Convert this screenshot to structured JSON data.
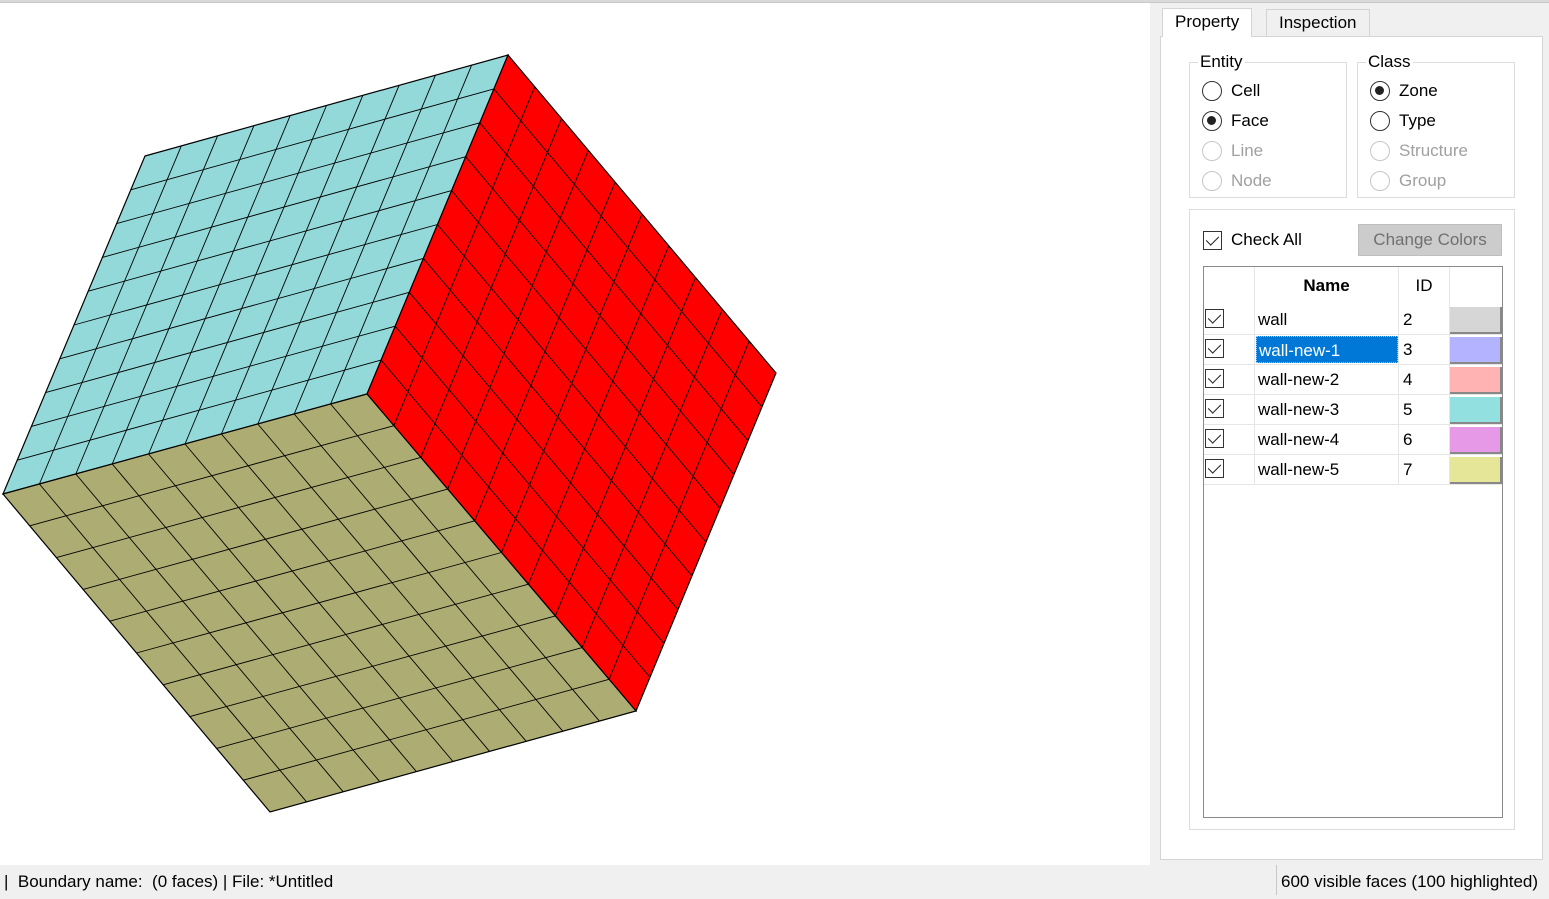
{
  "tabs": [
    {
      "label": "Property",
      "active": true
    },
    {
      "label": "Inspection",
      "active": false
    }
  ],
  "entity": {
    "label": "Entity",
    "options": [
      {
        "label": "Cell",
        "checked": false,
        "enabled": true
      },
      {
        "label": "Face",
        "checked": true,
        "enabled": true
      },
      {
        "label": "Line",
        "checked": false,
        "enabled": false
      },
      {
        "label": "Node",
        "checked": false,
        "enabled": false
      }
    ]
  },
  "class_group": {
    "label": "Class",
    "options": [
      {
        "label": "Zone",
        "checked": true,
        "enabled": true
      },
      {
        "label": "Type",
        "checked": false,
        "enabled": true
      },
      {
        "label": "Structure",
        "checked": false,
        "enabled": false
      },
      {
        "label": "Group",
        "checked": false,
        "enabled": false
      }
    ]
  },
  "zones": {
    "check_all_label": "Check All",
    "check_all": true,
    "change_colors_label": "Change Colors",
    "columns": {
      "name": "Name",
      "id": "ID"
    },
    "rows": [
      {
        "checked": true,
        "name": "wall",
        "id": "2",
        "color": "#d6d6d6",
        "selected": false
      },
      {
        "checked": true,
        "name": "wall-new-1",
        "id": "3",
        "color": "#b3b3ff",
        "selected": true
      },
      {
        "checked": true,
        "name": "wall-new-2",
        "id": "4",
        "color": "#ffb3b3",
        "selected": false
      },
      {
        "checked": true,
        "name": "wall-new-3",
        "id": "5",
        "color": "#93e0e0",
        "selected": false
      },
      {
        "checked": true,
        "name": "wall-new-4",
        "id": "6",
        "color": "#e699e6",
        "selected": false
      },
      {
        "checked": true,
        "name": "wall-new-5",
        "id": "7",
        "color": "#e6e699",
        "selected": false
      }
    ]
  },
  "viewport": {
    "face_colors": {
      "top": "#93d9d9",
      "right": "#ff0000",
      "bottom": "#adad73"
    },
    "grid": 10,
    "edge_color": "#000000"
  },
  "status": {
    "left": "|  Boundary name:  (0 faces) | File: *Untitled",
    "right": "600 visible faces (100 highlighted)"
  }
}
